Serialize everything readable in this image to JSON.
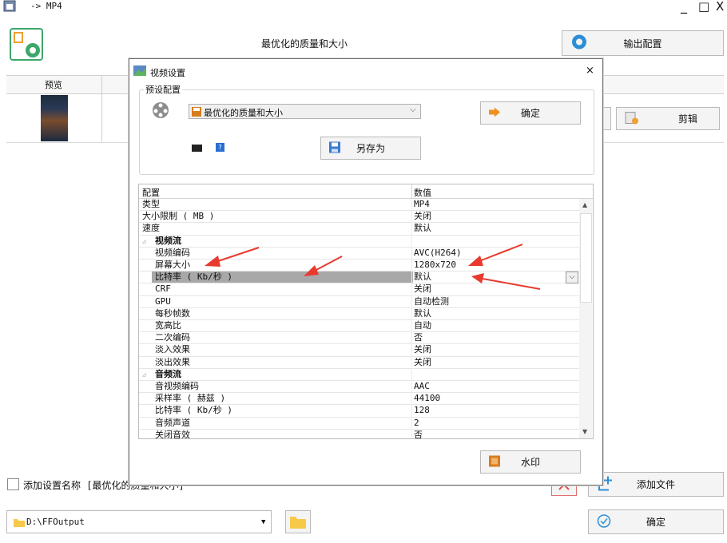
{
  "window": {
    "title": "-> MP4",
    "minimize": "_",
    "maximize": "□",
    "close": "X"
  },
  "header": {
    "preset_label": "最优化的质量和大小",
    "output_config_btn": "输出配置"
  },
  "list": {
    "col_preview": "预览",
    "clip_btn": "剪辑"
  },
  "bottom": {
    "add_name_checkbox_label": "添加设置名称 [最优化的质量和大小]",
    "output_path": "D:\\FFOutput",
    "add_file_btn": "添加文件",
    "ok_btn": "确定"
  },
  "dialog": {
    "title": "视频设置",
    "close": "×",
    "group_label": "预设配置",
    "preset_select": "最优化的质量和大小",
    "ok_btn": "确定",
    "save_as_btn": "另存为",
    "watermark_btn": "水印",
    "help_label": "?",
    "grid": {
      "col_config": "配置",
      "col_value": "数值",
      "rows": [
        {
          "k": "类型",
          "v": "MP4",
          "indent": 0
        },
        {
          "k": "大小限制 ( MB )",
          "v": "关闭",
          "indent": 0
        },
        {
          "k": "速度",
          "v": "默认",
          "indent": 0
        },
        {
          "k": "视频流",
          "v": "",
          "indent": 0,
          "category": true
        },
        {
          "k": "视频编码",
          "v": "AVC(H264)",
          "indent": 1
        },
        {
          "k": "屏幕大小",
          "v": "1280x720",
          "indent": 1
        },
        {
          "k": "比特率 ( Kb/秒 )",
          "v": "默认",
          "indent": 1,
          "selected": true
        },
        {
          "k": "CRF",
          "v": "关闭",
          "indent": 1
        },
        {
          "k": "GPU",
          "v": "自动检测",
          "indent": 1
        },
        {
          "k": "每秒帧数",
          "v": "默认",
          "indent": 1
        },
        {
          "k": "宽高比",
          "v": "自动",
          "indent": 1
        },
        {
          "k": "二次编码",
          "v": "否",
          "indent": 1
        },
        {
          "k": "淡入效果",
          "v": "关闭",
          "indent": 1
        },
        {
          "k": "淡出效果",
          "v": "关闭",
          "indent": 1
        },
        {
          "k": "音频流",
          "v": "",
          "indent": 0,
          "category": true
        },
        {
          "k": "音视频编码",
          "v": "AAC",
          "indent": 1
        },
        {
          "k": "采样率 ( 赫兹 )",
          "v": "44100",
          "indent": 1
        },
        {
          "k": "比特率 ( Kb/秒 )",
          "v": "128",
          "indent": 1
        },
        {
          "k": "音频声道",
          "v": "2",
          "indent": 1
        },
        {
          "k": "关闭音效",
          "v": "否",
          "indent": 1
        }
      ]
    }
  },
  "colors": {
    "accent_green": "#3ca86a",
    "annotation_red": "#e83a2e",
    "selection": "#a8a8a8",
    "folder_yellow": "#f7c948"
  }
}
